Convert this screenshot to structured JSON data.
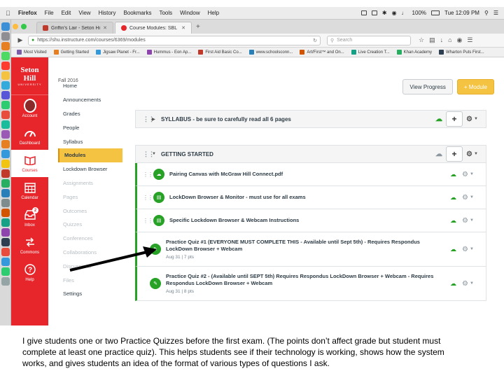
{
  "menubar": {
    "app": "Firefox",
    "menus": [
      "File",
      "Edit",
      "View",
      "History",
      "Bookmarks",
      "Tools",
      "Window",
      "Help"
    ],
    "battery": "100%",
    "clock": "Tue 12:09 PM"
  },
  "tabs": [
    {
      "label": "Griffin's Lair - Seton Hill Un...",
      "active": false
    },
    {
      "label": "Course Modules: SBL 1417...",
      "active": true
    }
  ],
  "url": "https://shu.instructure.com/courses/6369/modules",
  "search_placeholder": "Search",
  "bookmarks": [
    "Most Visited",
    "Getting Started",
    "Jigsaw Planet - Fr...",
    "Hummus - Eon Ap...",
    "First Aid Basic Co...",
    "www.schoolsconn...",
    "Art/First™ and On...",
    "Live Creation T...",
    "Khan Academy",
    "Wharton Puts First..."
  ],
  "global_nav": {
    "logo_line1": "Seton",
    "logo_line2": "Hill",
    "logo_line3": "UNIVERSITY",
    "items": [
      {
        "label": "Account",
        "icon": "avatar-icon"
      },
      {
        "label": "Dashboard",
        "icon": "dashboard-icon"
      },
      {
        "label": "Courses",
        "icon": "book-icon",
        "active": true
      },
      {
        "label": "Calendar",
        "icon": "calendar-icon"
      },
      {
        "label": "Inbox",
        "icon": "inbox-icon",
        "badge": "2"
      },
      {
        "label": "Commons",
        "icon": "commons-icon"
      },
      {
        "label": "Help",
        "icon": "help-icon"
      }
    ]
  },
  "term": "Fall 2016",
  "course_nav": [
    {
      "label": "Home",
      "state": "normal"
    },
    {
      "label": "Announcements",
      "state": "normal"
    },
    {
      "label": "Grades",
      "state": "normal"
    },
    {
      "label": "People",
      "state": "normal"
    },
    {
      "label": "Syllabus",
      "state": "normal"
    },
    {
      "label": "Modules",
      "state": "active"
    },
    {
      "label": "Lockdown Browser",
      "state": "normal"
    },
    {
      "label": "Assignments",
      "state": "disabled"
    },
    {
      "label": "Pages",
      "state": "disabled"
    },
    {
      "label": "Outcomes",
      "state": "disabled"
    },
    {
      "label": "Quizzes",
      "state": "disabled"
    },
    {
      "label": "Conferences",
      "state": "disabled"
    },
    {
      "label": "Collaborations",
      "state": "disabled"
    },
    {
      "label": "Discussions",
      "state": "disabled"
    },
    {
      "label": "Files",
      "state": "disabled"
    },
    {
      "label": "Settings",
      "state": "normal"
    }
  ],
  "buttons": {
    "view_progress": "View Progress",
    "add_module": "+ Module"
  },
  "modules": [
    {
      "title": "SYLLABUS - be sure to carefully read all 6 pages",
      "collapsed": true,
      "items": []
    },
    {
      "title": "GETTING STARTED",
      "collapsed": false,
      "items": [
        {
          "title": "Pairing Canvas with McGraw Hill Connect.pdf",
          "type": "file",
          "meta": ""
        },
        {
          "title": "LockDown Browser & Monitor - must use for all exams",
          "type": "page",
          "meta": ""
        },
        {
          "title": "Specific Lockdown Browser & Webcam Instructions",
          "type": "page",
          "meta": ""
        },
        {
          "title": "Practice Quiz #1 (EVERYONE MUST COMPLETE THIS - Available until Sept 5th) - Requires Respondus LockDown Browser + Webcam",
          "type": "quiz",
          "meta": "Aug 31  |  7 pts"
        },
        {
          "title": "Practice Quiz #2 - (Available until SEPT 5th) Requires Respondus LockDown Browser + Webcam - Requires Respondus LockDown Browser + Webcam",
          "type": "quiz",
          "meta": "Aug 31  |  8 pts"
        }
      ]
    }
  ],
  "caption": "I give students one or two Practice Quizzes before the first exam. (The points don’t affect grade but student must complete at least one practice quiz). This helps students see if their technology is working, shows how the system works, and gives students an idea of the format of various types of questions I ask.",
  "colors": {
    "brand_red": "#e7262c",
    "active_yellow": "#f5c342",
    "published_green": "#27a227"
  }
}
